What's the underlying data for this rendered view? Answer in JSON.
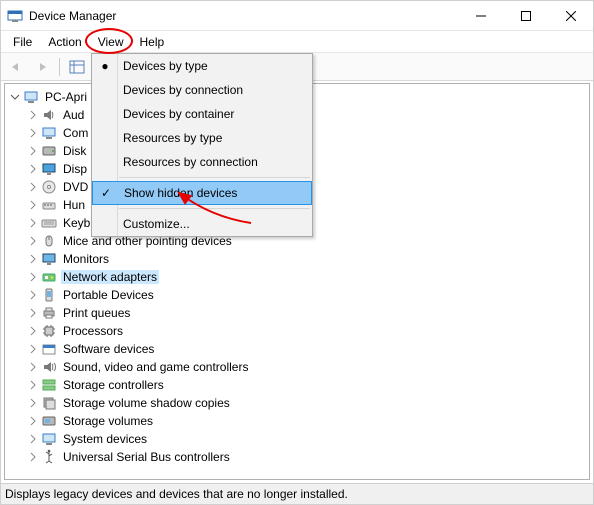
{
  "window": {
    "title": "Device Manager"
  },
  "menubar": {
    "file": "File",
    "action": "Action",
    "view": "View",
    "help": "Help"
  },
  "view_menu": {
    "devices_by_type": "Devices by type",
    "devices_by_connection": "Devices by connection",
    "devices_by_container": "Devices by container",
    "resources_by_type": "Resources by type",
    "resources_by_connection": "Resources by connection",
    "show_hidden": "Show hidden devices",
    "customize": "Customize..."
  },
  "tree": {
    "root": "PC-Apri",
    "items": [
      "Aud",
      "Com",
      "Disk",
      "Disp",
      "DVD",
      "Hun",
      "Keyb",
      "Mice and other pointing devices",
      "Monitors",
      "Network adapters",
      "Portable Devices",
      "Print queues",
      "Processors",
      "Software devices",
      "Sound, video and game controllers",
      "Storage controllers",
      "Storage volume shadow copies",
      "Storage volumes",
      "System devices",
      "Universal Serial Bus controllers"
    ],
    "selected_index": 9
  },
  "icons": [
    "speaker",
    "computer",
    "disk",
    "display",
    "dvd",
    "hid",
    "keyboard",
    "mouse",
    "monitor",
    "network",
    "portable",
    "printer",
    "processor",
    "software",
    "sound",
    "storagectl",
    "shadow",
    "volume",
    "system",
    "usb"
  ],
  "statusbar": {
    "text": "Displays legacy devices and devices that are no longer installed."
  }
}
